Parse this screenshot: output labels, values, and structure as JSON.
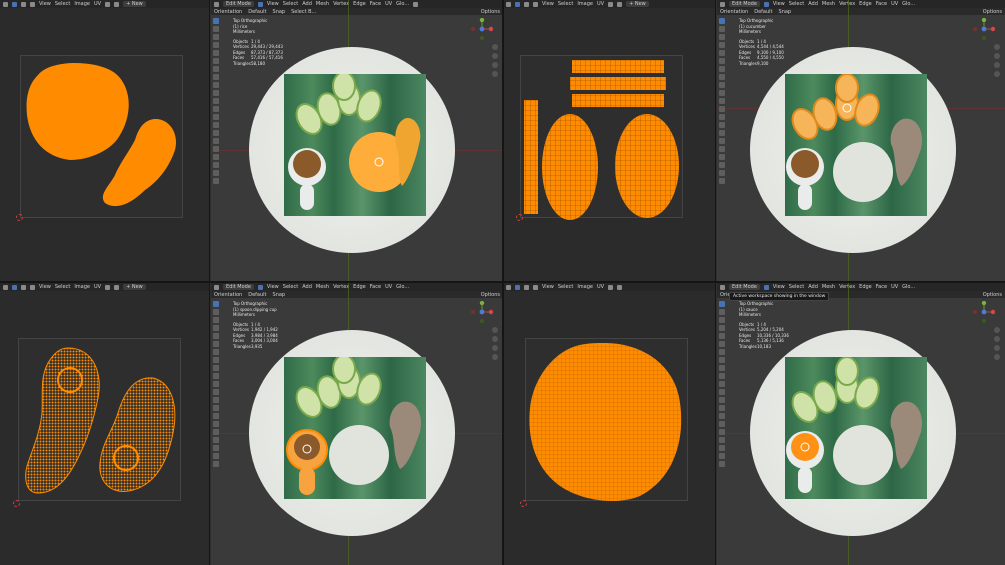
{
  "uv_header": {
    "menus": [
      "View",
      "Select",
      "Image",
      "UV"
    ]
  },
  "vp_header": {
    "mode": "Edit Mode",
    "menus": [
      "View",
      "Select",
      "Add",
      "Mesh",
      "Vertex",
      "Edge",
      "Face",
      "UV"
    ],
    "new_label": "+ New",
    "glo": "Glo...",
    "options": "Options",
    "orientation_label": "Orientation",
    "orientation_value": "Default",
    "snap": "Snap",
    "select_label": "Select B..."
  },
  "tooltip": "Active workspace showing in the window",
  "quadrants": [
    {
      "id": "top-left",
      "info": {
        "view": "Top Orthographic",
        "object": "(1) rice",
        "units": "Millimeters",
        "objects": "1 / 4",
        "vertices": "29,443 / 29,443",
        "edges": "87,373 / 87,373",
        "faces": "57,416 / 57,416",
        "triangles": "58,180"
      }
    },
    {
      "id": "top-right",
      "info": {
        "view": "Top Orthographic",
        "object": "(1) cucumber",
        "units": "Millimeters",
        "objects": "1 / 4",
        "vertices": "4,544 / 4,544",
        "edges": "9,100 / 9,100",
        "faces": "4,550 / 4,550",
        "triangles": "9,100"
      }
    },
    {
      "id": "bottom-left",
      "info": {
        "view": "Top Orthographic",
        "object": "(1) spoon.dipping cup",
        "units": "Millimeters",
        "objects": "1 / 4",
        "vertices": "1,942 / 1,942",
        "edges": "3,984 / 3,984",
        "faces": "3,004 / 3,004",
        "triangles": "3,935"
      }
    },
    {
      "id": "bottom-right",
      "info": {
        "view": "Top Orthographic",
        "object": "(1) sauce",
        "units": "Millimeters",
        "objects": "1 / 4",
        "vertices": "5,204 / 5,204",
        "edges": "10,336 / 10,336",
        "faces": "5,136 / 5,136",
        "triangles": "10,183"
      }
    }
  ],
  "labels": {
    "objects": "Objects",
    "vertices": "Vertices",
    "edges": "Edges",
    "faces": "Faces",
    "triangles": "Triangles"
  }
}
